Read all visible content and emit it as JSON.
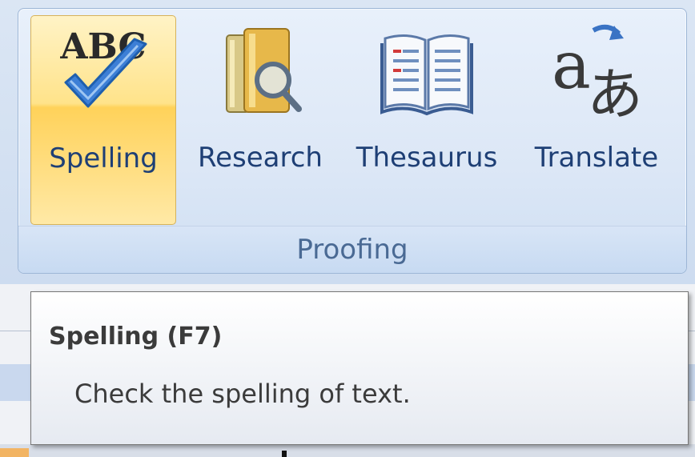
{
  "ribbon": {
    "group_label": "Proofing",
    "buttons": [
      {
        "label": "Spelling",
        "icon": "spelling-abc-check-icon",
        "active": true
      },
      {
        "label": "Research",
        "icon": "research-books-magnifier-icon"
      },
      {
        "label": "Thesaurus",
        "icon": "thesaurus-book-icon"
      },
      {
        "label": "Translate",
        "icon": "translate-icon"
      }
    ]
  },
  "tooltip": {
    "title": "Spelling (F7)",
    "description": "Check the spelling of text."
  },
  "colors": {
    "active_button": "#ffd25a",
    "label_text": "#1e3f75",
    "group_label_text": "#4a6a94"
  }
}
